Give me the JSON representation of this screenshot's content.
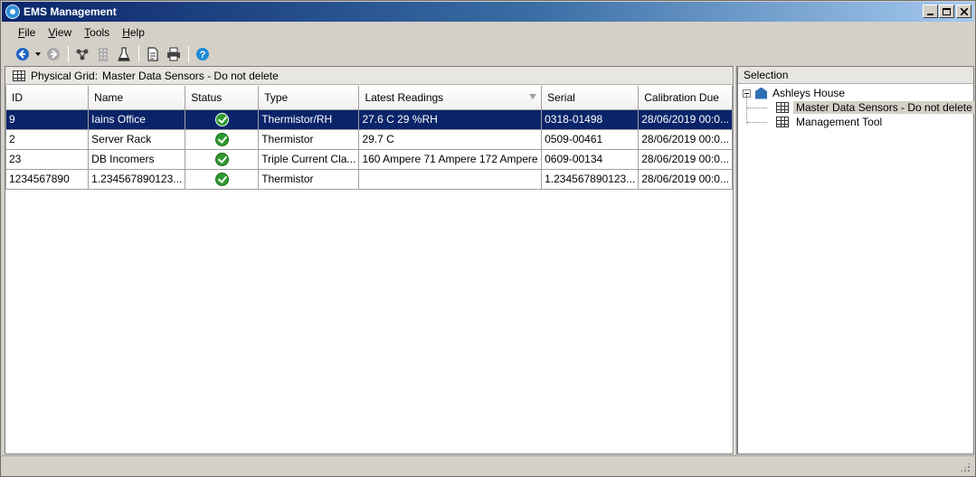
{
  "window": {
    "title": "EMS Management"
  },
  "menu": [
    {
      "label": "File",
      "ul": "F",
      "rest": "ile"
    },
    {
      "label": "View",
      "ul": "V",
      "rest": "iew"
    },
    {
      "label": "Tools",
      "ul": "T",
      "rest": "ools"
    },
    {
      "label": "Help",
      "ul": "H",
      "rest": "elp"
    }
  ],
  "toolbar": {
    "icons": [
      "back-icon",
      "dropdown-arrow-icon",
      "forward-icon",
      "connect-icon",
      "building-icon",
      "lab-flask-icon",
      "document-icon",
      "print-icon",
      "help-icon"
    ]
  },
  "grid_panel": {
    "label": "Physical Grid:",
    "name": "Master Data Sensors - Do not delete",
    "columns": [
      "ID",
      "Name",
      "Status",
      "Type",
      "Latest Readings",
      "Serial",
      "Calibration Due"
    ],
    "rows": [
      {
        "id": "9",
        "name": "Iains Office",
        "status": "ok",
        "type": "Thermistor/RH",
        "readings": "27.6 C 29 %RH",
        "serial": "0318-01498",
        "calibration": "28/06/2019 00:0...",
        "selected": true
      },
      {
        "id": "2",
        "name": "Server Rack",
        "status": "ok",
        "type": "Thermistor",
        "readings": "29.7 C",
        "serial": "0509-00461",
        "calibration": "28/06/2019 00:0...",
        "selected": false
      },
      {
        "id": "23",
        "name": "DB Incomers",
        "status": "ok",
        "type": "Triple Current Cla...",
        "readings": "160 Ampere 71 Ampere 172 Ampere",
        "serial": "0609-00134",
        "calibration": "28/06/2019 00:0...",
        "selected": false
      },
      {
        "id": "1234567890",
        "name": "1.234567890123...",
        "status": "ok",
        "type": "Thermistor",
        "readings": "",
        "serial": "1.2345678901​23...",
        "calibration": "28/06/2019 00:0...",
        "selected": false
      }
    ]
  },
  "selection_panel": {
    "title": "Selection",
    "root": "Ashleys House",
    "children": [
      "Master Data Sensors - Do not delete",
      "Management Tool"
    ]
  },
  "colors": {
    "selection": "#0a246a",
    "status_ok": "#2e9a2e"
  }
}
